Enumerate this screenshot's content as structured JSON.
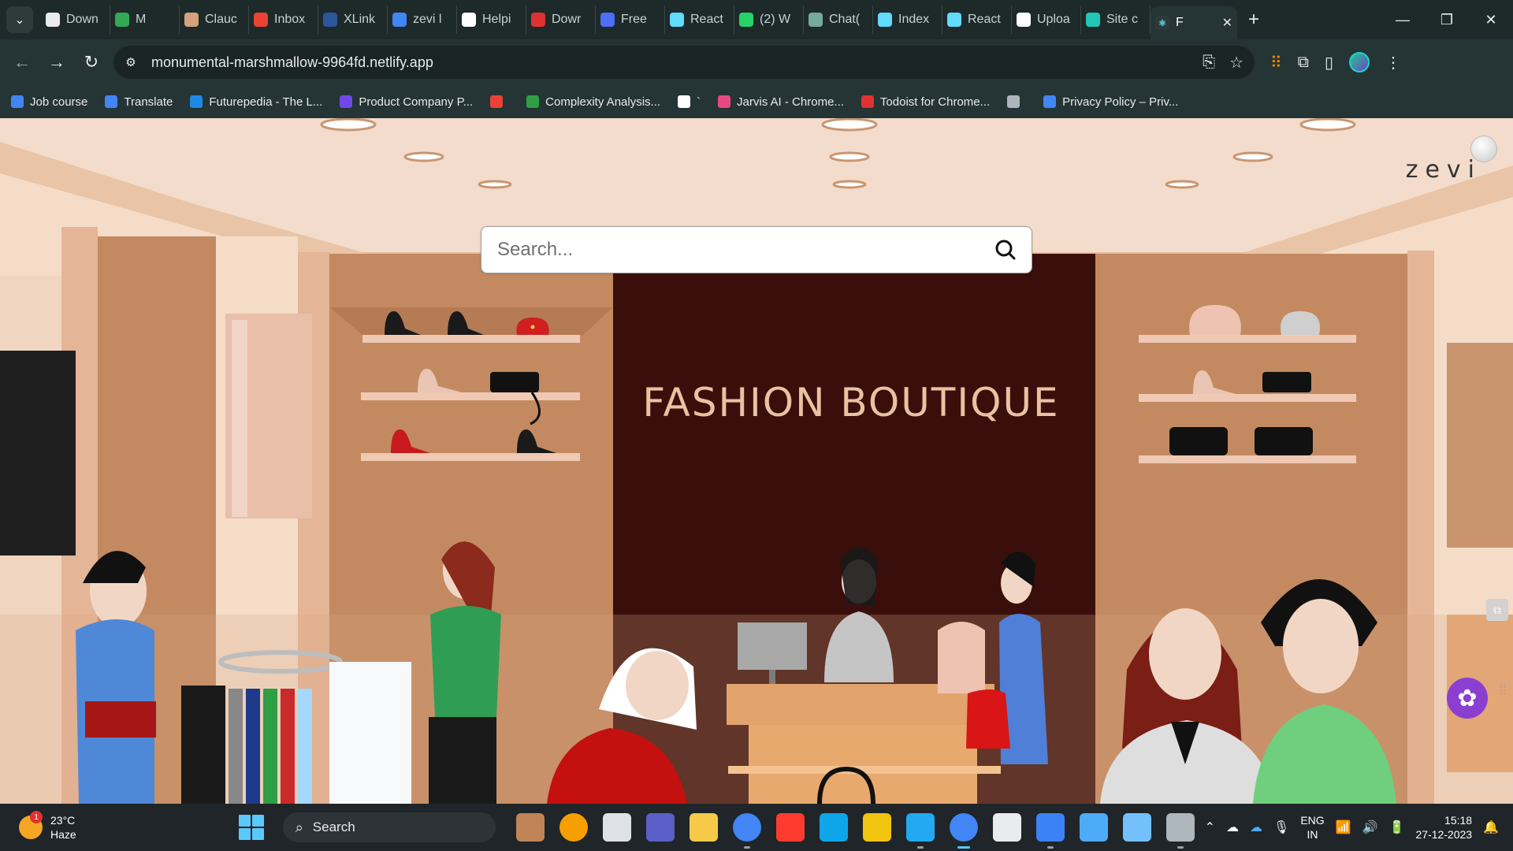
{
  "browser": {
    "tabs": [
      {
        "label": "Down",
        "icon": "download-icon",
        "color": "#e8eaed"
      },
      {
        "label": "M",
        "icon": "google-meet-icon",
        "color": "#34a853"
      },
      {
        "label": "Clauc",
        "icon": "anthropic-icon",
        "color": "#d4a27f"
      },
      {
        "label": "Inbox",
        "icon": "gmail-icon",
        "color": "#ea4335"
      },
      {
        "label": "XLink",
        "icon": "word-icon",
        "color": "#2b579a"
      },
      {
        "label": "zevi l",
        "icon": "google-icon",
        "color": "#4285f4"
      },
      {
        "label": "Helpi",
        "icon": "openai-icon",
        "color": "#ffffff"
      },
      {
        "label": "Dowr",
        "icon": "pdf-icon",
        "color": "#e03131"
      },
      {
        "label": "Free",
        "icon": "form-icon",
        "color": "#4c6ef5"
      },
      {
        "label": "React",
        "icon": "react-icon",
        "color": "#61dafb"
      },
      {
        "label": "(2) W",
        "icon": "whatsapp-icon",
        "color": "#25d366"
      },
      {
        "label": "Chat(",
        "icon": "chatgpt-icon",
        "color": "#74aa9c"
      },
      {
        "label": "Index",
        "icon": "react-icon",
        "color": "#61dafb"
      },
      {
        "label": "React",
        "icon": "react-icon",
        "color": "#61dafb"
      },
      {
        "label": "Uploa",
        "icon": "github-icon",
        "color": "#ffffff"
      },
      {
        "label": "Site c",
        "icon": "netlify-icon",
        "color": "#20c6b7"
      }
    ],
    "active_tab": {
      "label": "F",
      "icon": "react-icon",
      "close": "✕"
    },
    "new_tab": "+",
    "url": "monumental-marshmallow-9964fd.netlify.app",
    "bookmarks": [
      {
        "label": "Job course",
        "color": "#4285f4"
      },
      {
        "label": "Translate",
        "color": "#4285f4"
      },
      {
        "label": "Futurepedia - The L...",
        "color": "#1e88e5"
      },
      {
        "label": "Product Company P...",
        "color": "#7048e8"
      },
      {
        "label": "",
        "color": "#ea4335"
      },
      {
        "label": "Complexity Analysis...",
        "color": "#2f9e44"
      },
      {
        "label": "`",
        "color": "#ffffff"
      },
      {
        "label": "Jarvis AI - Chrome...",
        "color": "#e64980"
      },
      {
        "label": "Todoist for Chrome...",
        "color": "#e03131"
      },
      {
        "label": "",
        "color": "#adb5bd"
      },
      {
        "label": "Privacy Policy – Priv...",
        "color": "#4285f4"
      }
    ]
  },
  "site": {
    "brand": "zevi",
    "search_placeholder": "Search...",
    "sign_text": "FASHION BOUTIQUE"
  },
  "taskbar": {
    "weather_temp": "23°C",
    "weather_desc": "Haze",
    "weather_badge": "1",
    "search_label": "Search",
    "lang_1": "ENG",
    "lang_2": "IN",
    "time": "15:18",
    "date": "27-12-2023",
    "apps": [
      {
        "name": "widget-app-icon",
        "color": "#c08457"
      },
      {
        "name": "chrome-canary-app-icon",
        "color": "#f59f00"
      },
      {
        "name": "task-view-icon",
        "color": "#dee2e6"
      },
      {
        "name": "teams-app-icon",
        "color": "#5b5fc7"
      },
      {
        "name": "file-explorer-icon",
        "color": "#f7c948"
      },
      {
        "name": "chrome-app-icon",
        "color": "#4285f4"
      },
      {
        "name": "app-red-diamond-icon",
        "color": "#ff3b30"
      },
      {
        "name": "edge-app-icon",
        "color": "#0ea5e9"
      },
      {
        "name": "store-app-icon",
        "color": "#f1c40f"
      },
      {
        "name": "vscode-app-icon",
        "color": "#23a9f2"
      },
      {
        "name": "chrome-active-app-icon",
        "color": "#4285f4"
      },
      {
        "name": "snipping-tool-icon",
        "color": "#e9ecef"
      },
      {
        "name": "photos-app-icon",
        "color": "#3b82f6"
      },
      {
        "name": "notepad-app-icon",
        "color": "#4dabf7"
      },
      {
        "name": "app-arrow-icon",
        "color": "#74c0fc"
      },
      {
        "name": "terminal-app-icon",
        "color": "#adb5bd"
      }
    ]
  }
}
